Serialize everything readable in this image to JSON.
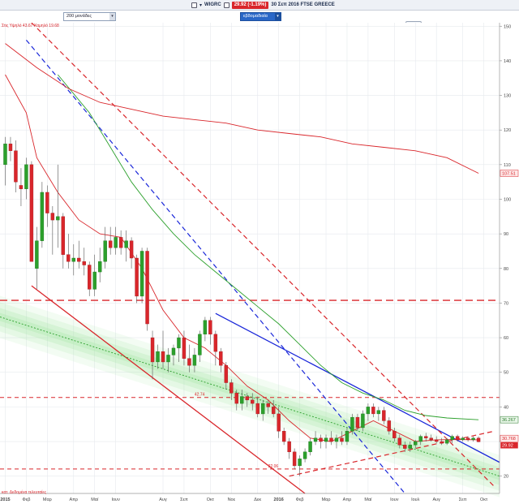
{
  "header": {
    "ticker": "WIGRC",
    "price_badge": "29.92 (-1.19%)",
    "date_label": "30 Σεπ 2016 FTSE GREECE"
  },
  "toolbar": {
    "bars_select": "200 μονάδες",
    "period_select": "εβδομαδιαία"
  },
  "chart_data": {
    "type": "candlestick",
    "legend_text": "Στις Υψηλό 43.67 Χαμηλό 19.68",
    "bottom_note": "κατ. Δεδομένα τελευταίες",
    "y_ticks": [
      20,
      30,
      40,
      50,
      60,
      70,
      80,
      90,
      100,
      110,
      120,
      130,
      140,
      150
    ],
    "ylim": [
      15,
      151
    ],
    "x_ticks": [
      {
        "label": "2015",
        "x": 0
      },
      {
        "label": "Φεβ",
        "x": 4
      },
      {
        "label": "Μαρ",
        "x": 8
      },
      {
        "label": "Απρ",
        "x": 13
      },
      {
        "label": "Μαϊ",
        "x": 17
      },
      {
        "label": "Ιουν",
        "x": 21
      },
      {
        "label": "Αυγ",
        "x": 30
      },
      {
        "label": "Σεπ",
        "x": 34
      },
      {
        "label": "Οκτ",
        "x": 39
      },
      {
        "label": "Νοε",
        "x": 43
      },
      {
        "label": "Δεκ",
        "x": 48
      },
      {
        "label": "2016",
        "x": 52
      },
      {
        "label": "Φεβ",
        "x": 56
      },
      {
        "label": "Μαρ",
        "x": 61
      },
      {
        "label": "Απρ",
        "x": 65
      },
      {
        "label": "Μαϊ",
        "x": 69
      },
      {
        "label": "Ιουν",
        "x": 74
      },
      {
        "label": "Ιουλ",
        "x": 78
      },
      {
        "label": "Αυγ",
        "x": 82
      },
      {
        "label": "Σεπ",
        "x": 87
      },
      {
        "label": "Οκτ",
        "x": 91
      }
    ],
    "xlim": [
      -1,
      94
    ],
    "candles": [
      {
        "x": 0,
        "o": 110,
        "h": 118,
        "l": 104,
        "c": 116
      },
      {
        "x": 1,
        "o": 116,
        "h": 118,
        "l": 111,
        "c": 114
      },
      {
        "x": 2,
        "o": 114,
        "h": 117,
        "l": 102,
        "c": 105
      },
      {
        "x": 3,
        "o": 104,
        "h": 109,
        "l": 98,
        "c": 103
      },
      {
        "x": 4,
        "o": 103,
        "h": 112,
        "l": 100,
        "c": 110
      },
      {
        "x": 5,
        "o": 110,
        "h": 111,
        "l": 95,
        "c": 82
      },
      {
        "x": 6,
        "o": 80,
        "h": 92,
        "l": 74,
        "c": 88
      },
      {
        "x": 7,
        "o": 88,
        "h": 105,
        "l": 86,
        "c": 102
      },
      {
        "x": 8,
        "o": 102,
        "h": 104,
        "l": 92,
        "c": 96
      },
      {
        "x": 9,
        "o": 96,
        "h": 98,
        "l": 84,
        "c": 94
      },
      {
        "x": 10,
        "o": 94,
        "h": 110,
        "l": 86,
        "c": 95
      },
      {
        "x": 11,
        "o": 95,
        "h": 96,
        "l": 80,
        "c": 84
      },
      {
        "x": 12,
        "o": 84,
        "h": 90,
        "l": 80,
        "c": 82
      },
      {
        "x": 13,
        "o": 82,
        "h": 87,
        "l": 78,
        "c": 83
      },
      {
        "x": 14,
        "o": 83,
        "h": 88,
        "l": 80,
        "c": 82
      },
      {
        "x": 15,
        "o": 82,
        "h": 86,
        "l": 78,
        "c": 81
      },
      {
        "x": 16,
        "o": 81,
        "h": 82,
        "l": 72,
        "c": 74
      },
      {
        "x": 17,
        "o": 74,
        "h": 84,
        "l": 72,
        "c": 79
      },
      {
        "x": 18,
        "o": 79,
        "h": 86,
        "l": 76,
        "c": 82
      },
      {
        "x": 19,
        "o": 82,
        "h": 92,
        "l": 80,
        "c": 88
      },
      {
        "x": 20,
        "o": 88,
        "h": 92,
        "l": 84,
        "c": 86
      },
      {
        "x": 21,
        "o": 86,
        "h": 92,
        "l": 84,
        "c": 89
      },
      {
        "x": 22,
        "o": 89,
        "h": 91,
        "l": 84,
        "c": 86
      },
      {
        "x": 23,
        "o": 86,
        "h": 91,
        "l": 82,
        "c": 88
      },
      {
        "x": 24,
        "o": 88,
        "h": 89,
        "l": 80,
        "c": 83
      },
      {
        "x": 25,
        "o": 83,
        "h": 84,
        "l": 70,
        "c": 72
      },
      {
        "x": 26,
        "o": 72,
        "h": 86,
        "l": 70,
        "c": 85
      },
      {
        "x": 27,
        "o": 85,
        "h": 86,
        "l": 62,
        "c": 64
      },
      {
        "x": 28,
        "o": 60,
        "h": 62,
        "l": 48,
        "c": 53
      },
      {
        "x": 29,
        "o": 53,
        "h": 58,
        "l": 51,
        "c": 56
      },
      {
        "x": 30,
        "o": 56,
        "h": 62,
        "l": 51,
        "c": 53
      },
      {
        "x": 31,
        "o": 53,
        "h": 57,
        "l": 50,
        "c": 55
      },
      {
        "x": 32,
        "o": 55,
        "h": 58,
        "l": 52,
        "c": 57
      },
      {
        "x": 33,
        "o": 57,
        "h": 61,
        "l": 53,
        "c": 60
      },
      {
        "x": 34,
        "o": 60,
        "h": 62,
        "l": 52,
        "c": 54
      },
      {
        "x": 35,
        "o": 54,
        "h": 58,
        "l": 50,
        "c": 52
      },
      {
        "x": 36,
        "o": 52,
        "h": 57,
        "l": 50,
        "c": 55
      },
      {
        "x": 37,
        "o": 55,
        "h": 62,
        "l": 53,
        "c": 61
      },
      {
        "x": 38,
        "o": 61,
        "h": 66,
        "l": 59,
        "c": 65
      },
      {
        "x": 39,
        "o": 65,
        "h": 66,
        "l": 58,
        "c": 61
      },
      {
        "x": 40,
        "o": 61,
        "h": 62,
        "l": 52,
        "c": 56
      },
      {
        "x": 41,
        "o": 56,
        "h": 57,
        "l": 50,
        "c": 52
      },
      {
        "x": 42,
        "o": 52,
        "h": 53,
        "l": 45,
        "c": 47
      },
      {
        "x": 43,
        "o": 47,
        "h": 48,
        "l": 42,
        "c": 44
      },
      {
        "x": 44,
        "o": 44,
        "h": 45,
        "l": 39,
        "c": 41
      },
      {
        "x": 45,
        "o": 41,
        "h": 45,
        "l": 39,
        "c": 43
      },
      {
        "x": 46,
        "o": 43,
        "h": 44,
        "l": 40,
        "c": 42
      },
      {
        "x": 47,
        "o": 42,
        "h": 44,
        "l": 39,
        "c": 41
      },
      {
        "x": 48,
        "o": 41,
        "h": 43,
        "l": 37,
        "c": 38
      },
      {
        "x": 49,
        "o": 38,
        "h": 42,
        "l": 36,
        "c": 41
      },
      {
        "x": 50,
        "o": 41,
        "h": 42,
        "l": 38,
        "c": 40
      },
      {
        "x": 51,
        "o": 40,
        "h": 42,
        "l": 37,
        "c": 38
      },
      {
        "x": 52,
        "o": 38,
        "h": 40,
        "l": 31,
        "c": 33
      },
      {
        "x": 53,
        "o": 33,
        "h": 34,
        "l": 29,
        "c": 30
      },
      {
        "x": 54,
        "o": 30,
        "h": 31,
        "l": 25,
        "c": 27
      },
      {
        "x": 55,
        "o": 27,
        "h": 28,
        "l": 22,
        "c": 23
      },
      {
        "x": 56,
        "o": 23,
        "h": 26,
        "l": 20,
        "c": 25
      },
      {
        "x": 57,
        "o": 25,
        "h": 28,
        "l": 24,
        "c": 27
      },
      {
        "x": 58,
        "o": 27,
        "h": 31,
        "l": 26,
        "c": 30
      },
      {
        "x": 59,
        "o": 30,
        "h": 33,
        "l": 29,
        "c": 31
      },
      {
        "x": 60,
        "o": 31,
        "h": 32,
        "l": 28,
        "c": 30
      },
      {
        "x": 61,
        "o": 30,
        "h": 32,
        "l": 28,
        "c": 31
      },
      {
        "x": 62,
        "o": 31,
        "h": 33,
        "l": 29,
        "c": 30
      },
      {
        "x": 63,
        "o": 30,
        "h": 32,
        "l": 28,
        "c": 31
      },
      {
        "x": 64,
        "o": 31,
        "h": 33,
        "l": 29,
        "c": 30
      },
      {
        "x": 65,
        "o": 30,
        "h": 34,
        "l": 29,
        "c": 33
      },
      {
        "x": 66,
        "o": 33,
        "h": 38,
        "l": 32,
        "c": 37
      },
      {
        "x": 67,
        "o": 37,
        "h": 38,
        "l": 33,
        "c": 34
      },
      {
        "x": 68,
        "o": 34,
        "h": 39,
        "l": 33,
        "c": 38
      },
      {
        "x": 69,
        "o": 38,
        "h": 41,
        "l": 36,
        "c": 40
      },
      {
        "x": 70,
        "o": 40,
        "h": 41,
        "l": 37,
        "c": 38
      },
      {
        "x": 71,
        "o": 38,
        "h": 40,
        "l": 36,
        "c": 39
      },
      {
        "x": 72,
        "o": 39,
        "h": 40,
        "l": 35,
        "c": 36
      },
      {
        "x": 73,
        "o": 36,
        "h": 37,
        "l": 32,
        "c": 33
      },
      {
        "x": 74,
        "o": 33,
        "h": 34,
        "l": 30,
        "c": 31
      },
      {
        "x": 75,
        "o": 31,
        "h": 32,
        "l": 28,
        "c": 29
      },
      {
        "x": 76,
        "o": 29,
        "h": 30,
        "l": 27,
        "c": 28
      },
      {
        "x": 77,
        "o": 28,
        "h": 30,
        "l": 27,
        "c": 29
      },
      {
        "x": 78,
        "o": 29,
        "h": 30.5,
        "l": 28,
        "c": 30
      },
      {
        "x": 79,
        "o": 30,
        "h": 32,
        "l": 29,
        "c": 31.5
      },
      {
        "x": 80,
        "o": 31.5,
        "h": 32.5,
        "l": 30,
        "c": 31
      },
      {
        "x": 81,
        "o": 31,
        "h": 32,
        "l": 30,
        "c": 30.5
      },
      {
        "x": 82,
        "o": 30.5,
        "h": 31.5,
        "l": 29.5,
        "c": 30
      },
      {
        "x": 83,
        "o": 30,
        "h": 31,
        "l": 29,
        "c": 29.5
      },
      {
        "x": 84,
        "o": 29.5,
        "h": 31,
        "l": 29,
        "c": 30.5
      },
      {
        "x": 85,
        "o": 30.5,
        "h": 32,
        "l": 29.5,
        "c": 31.5
      },
      {
        "x": 86,
        "o": 31.5,
        "h": 32,
        "l": 30,
        "c": 30.5
      },
      {
        "x": 87,
        "o": 30.5,
        "h": 31.5,
        "l": 30,
        "c": 31
      },
      {
        "x": 88,
        "o": 31,
        "h": 31.5,
        "l": 30,
        "c": 30.5
      },
      {
        "x": 89,
        "o": 30.5,
        "h": 31.5,
        "l": 30,
        "c": 31
      },
      {
        "x": 90,
        "o": 31,
        "h": 31.5,
        "l": 29.8,
        "c": 29.92
      }
    ],
    "series": [
      {
        "style": "sma-short",
        "color": "#d9262b",
        "points": [
          [
            0,
            136
          ],
          [
            4,
            125
          ],
          [
            6,
            112
          ],
          [
            10,
            102
          ],
          [
            14,
            94
          ],
          [
            18,
            90
          ],
          [
            22,
            89
          ],
          [
            26,
            80
          ],
          [
            30,
            68
          ],
          [
            34,
            60
          ],
          [
            38,
            57
          ],
          [
            42,
            52
          ],
          [
            46,
            46
          ],
          [
            50,
            42
          ],
          [
            54,
            36
          ],
          [
            58,
            31
          ],
          [
            62,
            30
          ],
          [
            66,
            33
          ],
          [
            70,
            36
          ],
          [
            74,
            33
          ],
          [
            78,
            30
          ],
          [
            82,
            30.5
          ],
          [
            86,
            30.6
          ],
          [
            90,
            30.5
          ]
        ]
      },
      {
        "style": "sma-mid",
        "color": "#2ca02c",
        "points": [
          [
            10,
            136
          ],
          [
            16,
            125
          ],
          [
            20,
            115
          ],
          [
            24,
            105
          ],
          [
            28,
            97
          ],
          [
            32,
            90
          ],
          [
            36,
            84
          ],
          [
            40,
            79
          ],
          [
            44,
            74
          ],
          [
            48,
            69
          ],
          [
            52,
            64
          ],
          [
            56,
            58
          ],
          [
            60,
            52
          ],
          [
            64,
            47
          ],
          [
            68,
            44
          ],
          [
            72,
            42
          ],
          [
            76,
            39
          ],
          [
            80,
            37.5
          ],
          [
            84,
            36.8
          ],
          [
            90,
            36.3
          ]
        ]
      },
      {
        "style": "sma-long",
        "color": "#d9262b",
        "points": [
          [
            0,
            145
          ],
          [
            6,
            138
          ],
          [
            12,
            132
          ],
          [
            18,
            128
          ],
          [
            24,
            126
          ],
          [
            30,
            124
          ],
          [
            36,
            123
          ],
          [
            42,
            122
          ],
          [
            48,
            120
          ],
          [
            54,
            119
          ],
          [
            60,
            118
          ],
          [
            66,
            116
          ],
          [
            72,
            115
          ],
          [
            78,
            114
          ],
          [
            84,
            112
          ],
          [
            90,
            107.5
          ]
        ]
      }
    ],
    "trendlines": [
      {
        "style": "solid",
        "color": "#1a27d9",
        "from": [
          40,
          67
        ],
        "to": [
          94,
          24
        ]
      },
      {
        "style": "dashed",
        "color": "#1a27d9",
        "from": [
          4,
          146
        ],
        "to": [
          76,
          15
        ]
      },
      {
        "style": "dashed",
        "color": "#d9262b",
        "from": [
          5,
          151
        ],
        "to": [
          93,
          17
        ]
      },
      {
        "style": "solid",
        "color": "#d9262b",
        "from": [
          5,
          75
        ],
        "to": [
          57,
          15
        ]
      },
      {
        "style": "dashed",
        "color": "#d9262b",
        "from": [
          54,
          20
        ],
        "to": [
          93,
          33
        ]
      },
      {
        "style": "dotted",
        "color": "#2ca02c",
        "from": [
          -1,
          66
        ],
        "to": [
          94,
          20
        ]
      }
    ],
    "channel": {
      "color": "#9fe59f",
      "from": [
        -1,
        66
      ],
      "to": [
        94,
        20
      ]
    },
    "hlines": [
      {
        "y": 70.8,
        "color": "#d9262b",
        "style": "dashed",
        "label": ""
      },
      {
        "y": 42.74,
        "color": "#d9262b",
        "style": "dashed",
        "label": "42.74"
      },
      {
        "y": 22.06,
        "color": "#d9262b",
        "style": "dashed",
        "label": "22.06"
      }
    ],
    "price_tags": [
      {
        "value": "107.51",
        "y": 107.5,
        "bg": "#fde8e8",
        "fg": "#d9262b"
      },
      {
        "value": "36.267",
        "y": 36.3,
        "bg": "#e8f6e8",
        "fg": "#2a7a2a"
      },
      {
        "value": "30.768",
        "y": 30.9,
        "bg": "#fdecec",
        "fg": "#d9262b"
      },
      {
        "value": "29.92",
        "y": 28.9,
        "bg": "#d9262b",
        "fg": "#ffffff"
      }
    ],
    "colors": {
      "up": "#2ca02c",
      "down": "#d9262b",
      "grid": "#e6e9ee"
    }
  }
}
